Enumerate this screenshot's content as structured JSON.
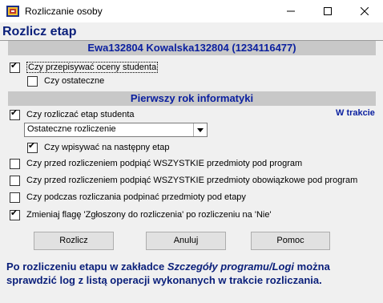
{
  "window": {
    "title": "Rozliczanie osoby"
  },
  "header": {
    "label": "Rozlicz etap"
  },
  "student_bar": "Ewa132804 Kowalska132804 (1234116477)",
  "options": {
    "rewrite_grades": {
      "label": "Czy przepisywać oceny studenta",
      "checked": true
    },
    "final": {
      "label": "Czy ostateczne",
      "checked": false
    }
  },
  "stage_bar": "Pierwszy rok informatyki",
  "stage": {
    "settle": {
      "label": "Czy rozliczać etap studenta",
      "checked": true
    },
    "status": "W trakcie",
    "mode_select": {
      "value": "Ostateczne rozliczenie"
    },
    "enroll_next": {
      "label": "Czy wpisywać na następny etap",
      "checked": true
    }
  },
  "checks": {
    "attach_all": {
      "label": "Czy przed rozliczeniem podpiąć WSZYSTKIE przedmioty pod program",
      "checked": false
    },
    "attach_mandatory": {
      "label": "Czy przed rozliczeniem podpiąć WSZYSTKIE przedmioty obowiązkowe pod program",
      "checked": false
    },
    "attach_stages": {
      "label": "Czy podczas rozliczania podpinać przedmioty pod etapy",
      "checked": false
    },
    "change_flag": {
      "label": "Zmieniaj flagę 'Zgłoszony do rozliczenia' po rozliczeniu na 'Nie'",
      "checked": true
    }
  },
  "buttons": {
    "settle": "Rozlicz",
    "cancel": "Anuluj",
    "help": "Pomoc"
  },
  "note": {
    "part1": "Po rozliczeniu etapu w zakładce ",
    "italic": "Szczegóły programu/Logi",
    "part2": " można sprawdzić log z listą operacji wykonanych w trakcie rozliczania."
  },
  "icons": {
    "app": "app-icon",
    "minimize": "minimize-icon",
    "maximize": "maximize-icon",
    "close": "close-icon",
    "dropdown": "chevron-down-icon"
  }
}
